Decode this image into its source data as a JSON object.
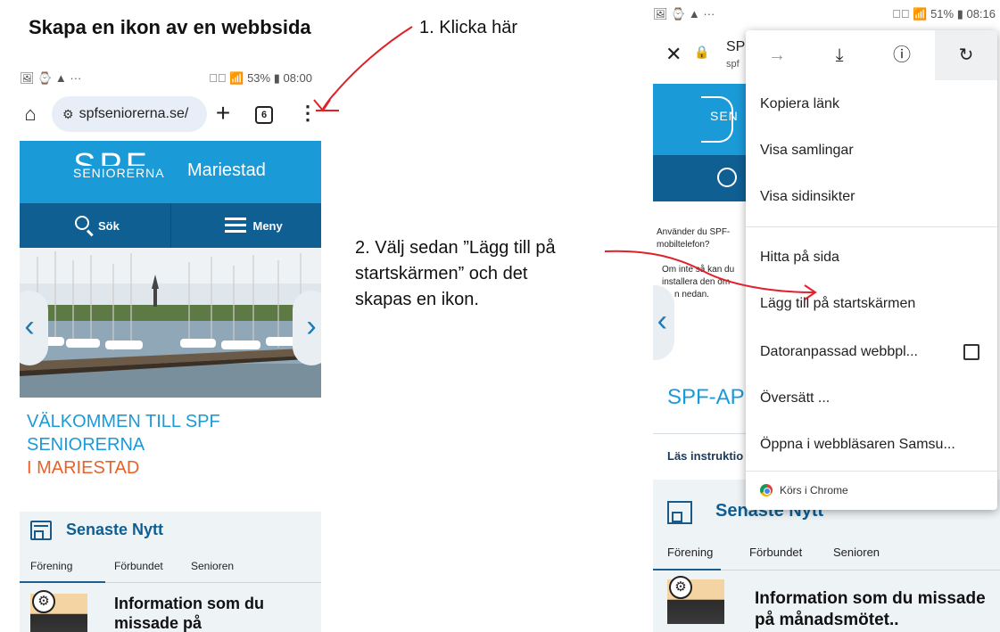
{
  "title": "Skapa en ikon av en webbsida",
  "step1": "1. Klicka här",
  "step2_lines": [
    "2. Välj sedan ”Lägg till på",
    "startskärmen” och det",
    "skapas en ikon."
  ],
  "left_phone": {
    "status_left": "🖼 ⌚ ▲ ···",
    "status_right": "✕⃝ 📶 53% ▮ 08:00",
    "url": "spfseniorerna.se/",
    "tab_count": "6",
    "logo_big": "SPF",
    "logo_small": "SENIORERNA",
    "city": "Mariestad",
    "search_label": "Sök",
    "menu_label": "Meny",
    "welcome_line1": "VÄLKOMMEN TILL SPF",
    "welcome_line2": "SENIORERNA",
    "welcome_line3": "I MARIESTAD",
    "news_title": "Senaste Nytt",
    "tabs": [
      "Förening",
      "Förbundet",
      "Senioren"
    ],
    "news_item_title": "Information som du missade på månadsmötet.."
  },
  "right_phone": {
    "status_left": "🖼 ⌚ ▲ ···",
    "status_right": "✕⃝ 📶 51% ▮ 08:16",
    "url_partial": "SP",
    "url_sub": "spf",
    "logo_partial": "SEN",
    "body_text": [
      "Använder du SPF-",
      "mobiltelefon?",
      "",
      "Om inte så kan du",
      "installera den om",
      "n nedan."
    ],
    "app_title": "SPF-APP",
    "instructions": "Läs instruktio",
    "news_title": "Senaste Nytt",
    "tabs": [
      "Förening",
      "Förbundet",
      "Senioren"
    ],
    "news_item_title": "Information som du missade på månadsmötet.."
  },
  "menu": {
    "items": [
      "Kopiera länk",
      "Visa samlingar",
      "Visa sidinsikter",
      "Hitta på sida",
      "Lägg till på startskärmen",
      "Datoranpassad webbpl...",
      "Översätt ...",
      "Öppna i webbläsaren Samsu..."
    ],
    "footer": "Körs i Chrome",
    "desktop_site_checked": false
  },
  "colors": {
    "brand_blue": "#1b9ad8",
    "nav_blue": "#0f5f93",
    "orange": "#e8622a",
    "arrow_red": "#e0212b"
  }
}
